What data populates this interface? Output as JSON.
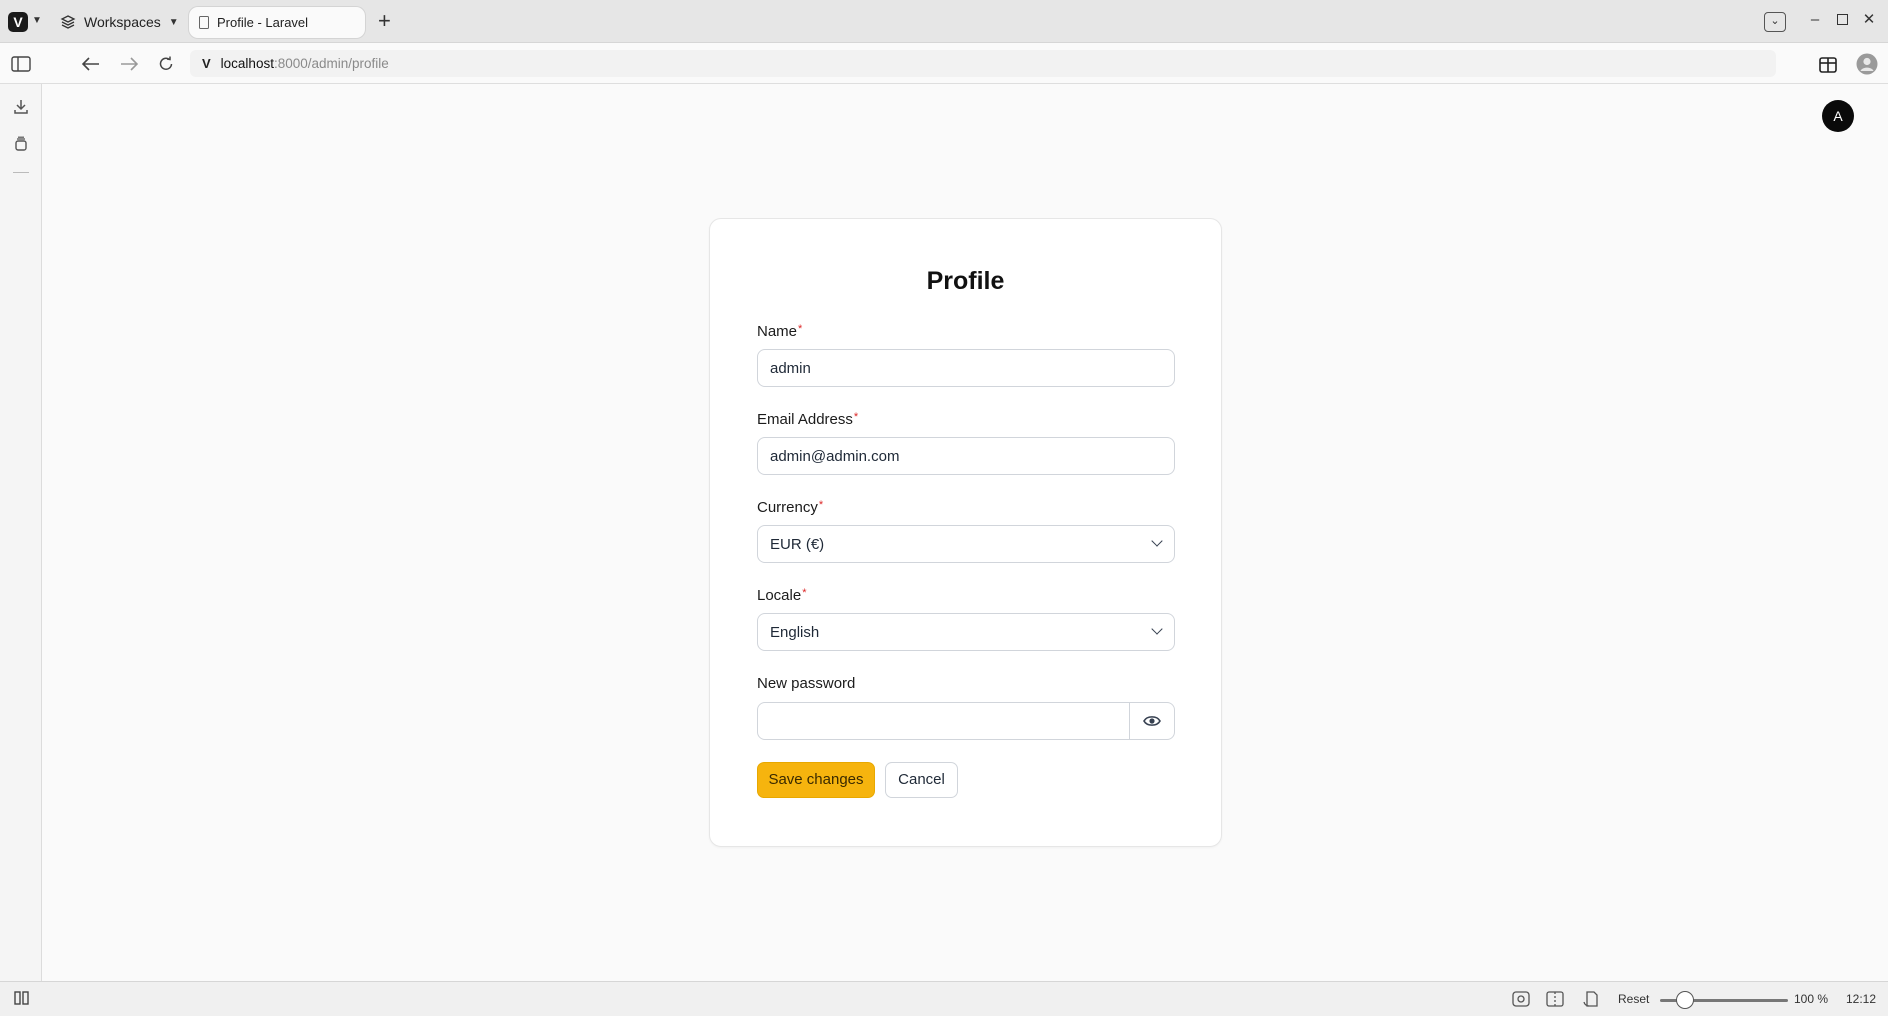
{
  "browser": {
    "workspaces_label": "Workspaces",
    "tab_title": "Profile - Laravel",
    "url_host": "localhost",
    "url_rest": ":8000/admin/profile"
  },
  "statusbar": {
    "reset_label": "Reset",
    "zoom_text": "100 %",
    "clock": "12:12"
  },
  "page": {
    "avatar_initial": "A",
    "title": "Profile",
    "fields": {
      "name": {
        "label": "Name",
        "required_mark": "*",
        "value": "admin"
      },
      "email": {
        "label": "Email Address",
        "required_mark": "*",
        "value": "admin@admin.com"
      },
      "currency": {
        "label": "Currency",
        "required_mark": "*",
        "value": "EUR (€)"
      },
      "locale": {
        "label": "Locale",
        "required_mark": "*",
        "value": "English"
      },
      "password": {
        "label": "New password",
        "value": ""
      }
    },
    "save_label": "Save changes",
    "cancel_label": "Cancel"
  },
  "colors": {
    "accent": "#f6b40e",
    "required": "#dc2626"
  }
}
